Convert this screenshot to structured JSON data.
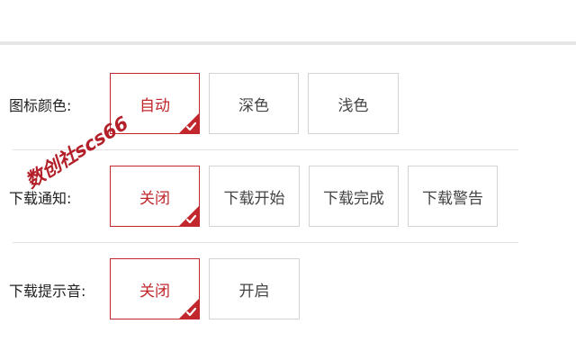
{
  "rows": [
    {
      "label": "图标颜色:",
      "options": [
        "自动",
        "深色",
        "浅色"
      ],
      "selected": 0
    },
    {
      "label": "下载通知:",
      "options": [
        "关闭",
        "下载开始",
        "下载完成",
        "下载警告"
      ],
      "selected": 0
    },
    {
      "label": "下载提示音:",
      "options": [
        "关闭",
        "开启"
      ],
      "selected": 0
    }
  ],
  "watermark": "数创社scs66",
  "colors": {
    "accent": "#c1272d",
    "border": "#d3d3d3",
    "text": "#444444"
  },
  "icons": {
    "selected_corner": "check-corner-icon"
  }
}
